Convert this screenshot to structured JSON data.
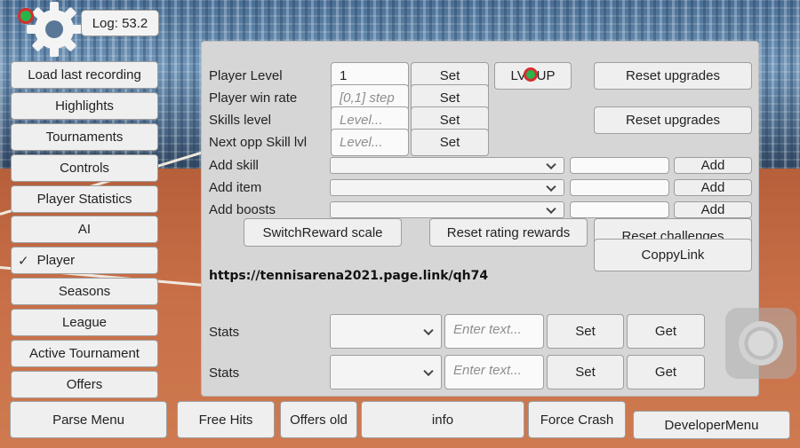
{
  "log": {
    "label": "Log: 53.2"
  },
  "left_menu": [
    {
      "label": "Load last recording"
    },
    {
      "label": "Highlights"
    },
    {
      "label": "Tournaments"
    },
    {
      "label": "Controls"
    },
    {
      "label": "Player Statistics"
    },
    {
      "label": "AI"
    },
    {
      "label": "Player",
      "checked": true
    },
    {
      "label": "Seasons"
    },
    {
      "label": "League"
    },
    {
      "label": "Active Tournament"
    },
    {
      "label": "Offers"
    }
  ],
  "panel": {
    "player_level": {
      "label": "Player Level",
      "value": "1",
      "set": "Set"
    },
    "player_win_rate": {
      "label": "Player win rate",
      "placeholder": "[0,1] step",
      "set": "Set"
    },
    "skills_level": {
      "label": "Skills level",
      "placeholder": "Level...",
      "set": "Set"
    },
    "next_opp_skill": {
      "label": "Next opp Skill lvl",
      "placeholder": "Level...",
      "set": "Set"
    },
    "lvl_up": "LVL UP",
    "reset_upgrades_1": "Reset upgrades",
    "reset_upgrades_2": "Reset upgrades",
    "add_skill": {
      "label": "Add skill",
      "button": "Add"
    },
    "add_item": {
      "label": "Add item",
      "button": "Add"
    },
    "add_boosts": {
      "label": "Add boosts",
      "button": "Add"
    },
    "switch_reward": "SwitchReward scale",
    "reset_rating": "Reset rating rewards",
    "reset_challenges": "Reset challenges",
    "copy_link": "CoppyLink",
    "link": "https://tennisarena2021.page.link/qh74",
    "stats_rows": [
      {
        "label": "Stats",
        "placeholder": "Enter text...",
        "set": "Set",
        "get": "Get"
      },
      {
        "label": "Stats",
        "placeholder": "Enter text...",
        "set": "Set",
        "get": "Get"
      }
    ]
  },
  "bottom_bar": {
    "parse_menu": "Parse Menu",
    "free_hits": "Free Hits",
    "offers_old": "Offers old",
    "info": "info",
    "force_crash": "Force Crash",
    "developer_menu": "DeveloperMenu"
  },
  "colors": {
    "panel_bg": "#d6d6d6",
    "button_bg": "#efefef",
    "court": "#c26a44",
    "record_dot": "#29b34a",
    "record_ring": "#d62e2e"
  }
}
